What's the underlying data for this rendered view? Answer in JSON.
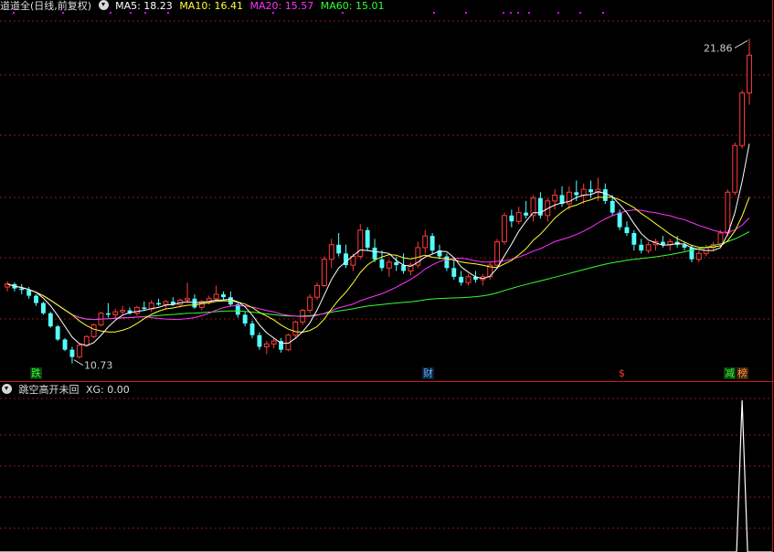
{
  "main_legend": {
    "title": "道道全(日线,前复权)",
    "ma5": "MA5: 18.23",
    "ma10": "MA10: 16.41",
    "ma20": "MA20: 15.57",
    "ma60": "MA60: 15.01"
  },
  "colors": {
    "up": "#ff3b3b",
    "down": "#54ffff",
    "ma5": "#ffffff",
    "ma10": "#ffff33",
    "ma20": "#ff33ff",
    "ma60": "#33ff33",
    "grid": "#8a1a1a",
    "divider": "#c21a1a",
    "signal": "#ff00ff"
  },
  "price_annotations": {
    "high": "21.86",
    "low": "10.73"
  },
  "event_tags": [
    {
      "text": "跌",
      "color": "#33ff33",
      "bg": "#0c3d0c"
    },
    {
      "text": "财",
      "color": "#5db8ff",
      "bg": "#0c1e3a"
    },
    {
      "text": "$",
      "color": "#ff3b3b",
      "bg": "#000000"
    },
    {
      "text": "减",
      "color": "#33ff33",
      "bg": "#0c3d0c"
    },
    {
      "text": "榜",
      "color": "#ff9a3b",
      "bg": "#3d220c"
    }
  ],
  "indicator_legend": {
    "title": "跳空高开未回",
    "xg": "XG: 0.00"
  },
  "chart_data": [
    {
      "type": "candlestick",
      "title": "道道全(日线,前复权)",
      "price_range": [
        10.5,
        22.5
      ],
      "high_marked": 21.86,
      "low_marked": 10.73,
      "series": [
        {
          "name": "MA5",
          "last": 18.23
        },
        {
          "name": "MA10",
          "last": 16.41
        },
        {
          "name": "MA20",
          "last": 15.57
        },
        {
          "name": "MA60",
          "last": 15.01
        }
      ],
      "candles": [
        [
          13.35,
          13.55,
          13.2,
          13.45
        ],
        [
          13.45,
          13.5,
          13.2,
          13.3
        ],
        [
          13.3,
          13.45,
          13.1,
          13.25
        ],
        [
          13.25,
          13.35,
          12.95,
          13.05
        ],
        [
          13.05,
          13.1,
          12.7,
          12.8
        ],
        [
          12.8,
          12.85,
          12.4,
          12.45
        ],
        [
          12.45,
          12.5,
          11.95,
          12.0
        ],
        [
          12.0,
          12.05,
          11.5,
          11.55
        ],
        [
          11.55,
          11.6,
          11.15,
          11.2
        ],
        [
          11.2,
          11.3,
          10.73,
          10.95
        ],
        [
          10.95,
          11.4,
          10.9,
          11.35
        ],
        [
          11.35,
          11.7,
          11.3,
          11.65
        ],
        [
          11.65,
          12.1,
          11.6,
          12.05
        ],
        [
          12.05,
          12.5,
          12.0,
          12.45
        ],
        [
          12.45,
          12.8,
          12.3,
          12.4
        ],
        [
          12.4,
          12.6,
          12.25,
          12.5
        ],
        [
          12.5,
          12.7,
          12.4,
          12.55
        ],
        [
          12.55,
          12.65,
          12.4,
          12.45
        ],
        [
          12.45,
          12.7,
          12.35,
          12.65
        ],
        [
          12.65,
          12.85,
          12.55,
          12.6
        ],
        [
          12.6,
          12.9,
          12.5,
          12.8
        ],
        [
          12.8,
          12.95,
          12.7,
          12.75
        ],
        [
          12.75,
          12.9,
          12.6,
          12.85
        ],
        [
          12.85,
          13.0,
          12.7,
          12.75
        ],
        [
          12.75,
          12.95,
          12.65,
          12.9
        ],
        [
          12.9,
          13.5,
          12.8,
          12.95
        ],
        [
          12.95,
          13.1,
          12.6,
          12.65
        ],
        [
          12.65,
          12.9,
          12.55,
          12.85
        ],
        [
          12.85,
          13.05,
          12.75,
          12.95
        ],
        [
          12.95,
          13.4,
          12.85,
          13.1
        ],
        [
          13.1,
          13.2,
          12.9,
          13.0
        ],
        [
          13.0,
          13.2,
          12.7,
          12.75
        ],
        [
          12.75,
          12.85,
          12.3,
          12.4
        ],
        [
          12.4,
          12.5,
          12.0,
          12.1
        ],
        [
          12.1,
          12.2,
          11.6,
          11.7
        ],
        [
          11.7,
          11.8,
          11.2,
          11.3
        ],
        [
          11.3,
          11.5,
          11.05,
          11.4
        ],
        [
          11.4,
          11.6,
          11.25,
          11.5
        ],
        [
          11.5,
          11.6,
          11.1,
          11.2
        ],
        [
          11.2,
          11.75,
          11.15,
          11.7
        ],
        [
          11.7,
          12.2,
          11.6,
          12.15
        ],
        [
          12.15,
          12.6,
          12.05,
          12.55
        ],
        [
          12.55,
          13.1,
          12.45,
          13.0
        ],
        [
          13.0,
          13.5,
          12.9,
          13.4
        ],
        [
          13.4,
          14.4,
          13.35,
          14.3
        ],
        [
          14.3,
          15.0,
          14.0,
          14.8
        ],
        [
          14.8,
          15.2,
          14.4,
          14.5
        ],
        [
          14.5,
          14.8,
          14.0,
          14.1
        ],
        [
          14.1,
          14.5,
          13.9,
          14.4
        ],
        [
          14.4,
          15.5,
          14.3,
          15.3
        ],
        [
          15.3,
          15.4,
          14.6,
          14.7
        ],
        [
          14.7,
          15.0,
          14.2,
          14.3
        ],
        [
          14.3,
          14.6,
          13.9,
          14.0
        ],
        [
          14.0,
          14.3,
          13.7,
          14.2
        ],
        [
          14.2,
          14.4,
          13.9,
          14.1
        ],
        [
          14.1,
          14.5,
          13.8,
          13.9
        ],
        [
          13.9,
          14.2,
          13.75,
          14.1
        ],
        [
          14.1,
          14.9,
          14.0,
          14.7
        ],
        [
          14.7,
          15.3,
          14.5,
          15.1
        ],
        [
          15.1,
          15.2,
          14.5,
          14.6
        ],
        [
          14.6,
          14.8,
          14.3,
          14.4
        ],
        [
          14.4,
          14.5,
          13.9,
          14.0
        ],
        [
          14.0,
          14.3,
          13.6,
          13.7
        ],
        [
          13.7,
          13.9,
          13.4,
          13.5
        ],
        [
          13.5,
          13.8,
          13.4,
          13.7
        ],
        [
          13.7,
          13.9,
          13.5,
          13.6
        ],
        [
          13.6,
          13.8,
          13.4,
          13.7
        ],
        [
          13.7,
          14.2,
          13.6,
          14.1
        ],
        [
          14.1,
          15.0,
          14.0,
          14.9
        ],
        [
          14.9,
          15.9,
          14.8,
          15.8
        ],
        [
          15.8,
          16.0,
          15.4,
          15.6
        ],
        [
          15.6,
          16.1,
          15.5,
          15.9
        ],
        [
          15.9,
          16.3,
          15.7,
          15.8
        ],
        [
          15.8,
          16.5,
          15.6,
          16.4
        ],
        [
          16.4,
          16.6,
          15.7,
          15.8
        ],
        [
          15.8,
          16.4,
          15.6,
          16.3
        ],
        [
          16.3,
          16.7,
          16.0,
          16.5
        ],
        [
          16.5,
          16.8,
          16.1,
          16.2
        ],
        [
          16.2,
          16.8,
          16.0,
          16.6
        ],
        [
          16.6,
          17.0,
          16.3,
          16.5
        ],
        [
          16.5,
          16.9,
          16.2,
          16.7
        ],
        [
          16.7,
          17.0,
          16.4,
          16.6
        ],
        [
          16.6,
          17.1,
          16.3,
          16.7
        ],
        [
          16.7,
          16.9,
          16.2,
          16.3
        ],
        [
          16.3,
          16.5,
          15.8,
          15.9
        ],
        [
          15.9,
          16.0,
          15.3,
          15.4
        ],
        [
          15.4,
          15.6,
          15.1,
          15.2
        ],
        [
          15.2,
          15.3,
          14.6,
          14.8
        ],
        [
          14.8,
          15.0,
          14.5,
          14.6
        ],
        [
          14.6,
          14.9,
          14.5,
          14.8
        ],
        [
          14.8,
          15.0,
          14.6,
          14.9
        ],
        [
          14.9,
          15.1,
          14.7,
          14.8
        ],
        [
          14.8,
          15.0,
          14.6,
          14.9
        ],
        [
          14.9,
          15.1,
          14.7,
          14.8
        ],
        [
          14.8,
          14.9,
          14.6,
          14.7
        ],
        [
          14.7,
          14.8,
          14.2,
          14.3
        ],
        [
          14.3,
          14.6,
          14.2,
          14.5
        ],
        [
          14.5,
          14.8,
          14.4,
          14.7
        ],
        [
          14.7,
          14.9,
          14.6,
          14.8
        ],
        [
          14.8,
          15.3,
          14.7,
          15.2
        ],
        [
          15.2,
          16.7,
          15.1,
          16.6
        ],
        [
          16.6,
          18.3,
          16.5,
          18.2
        ],
        [
          18.2,
          20.1,
          18.1,
          20.0
        ],
        [
          20.0,
          21.86,
          19.6,
          21.3
        ]
      ]
    },
    {
      "type": "line",
      "title": "跳空高开未回",
      "series": [
        {
          "name": "XG",
          "last": 0.0
        }
      ],
      "signal_at_index": 102
    }
  ]
}
